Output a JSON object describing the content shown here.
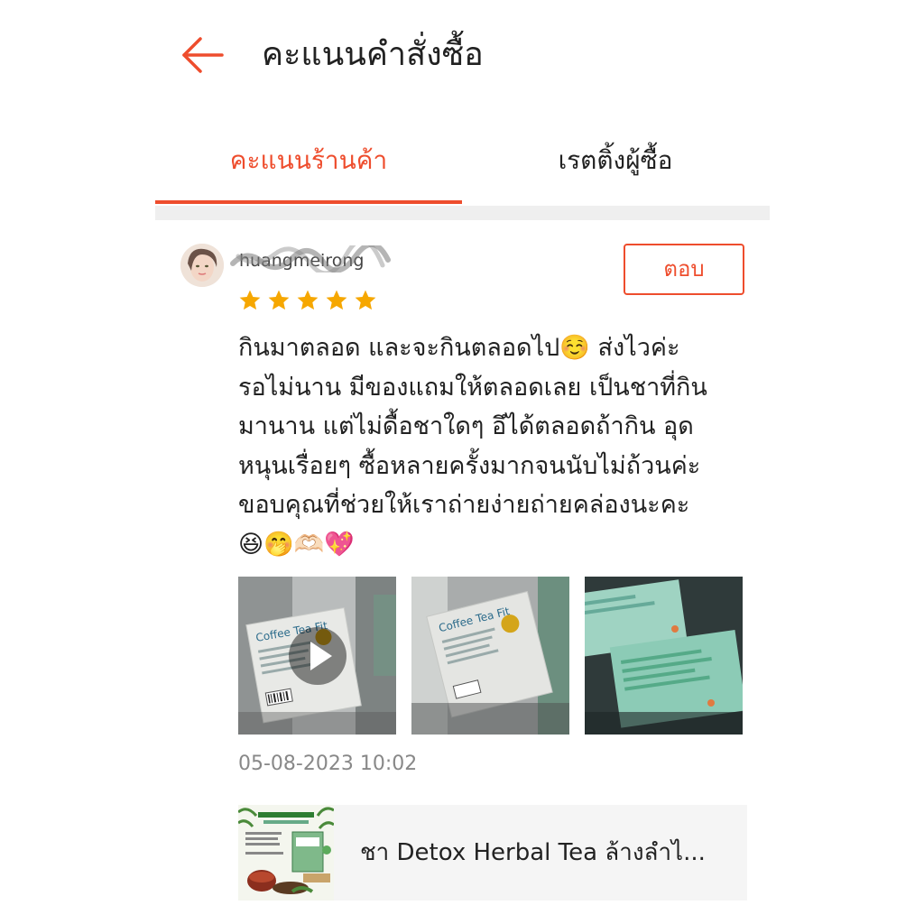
{
  "header": {
    "title": "คะแนนคำสั่งซื้อ",
    "back_icon": "arrow-left-icon",
    "accent_color": "#ee4d2d"
  },
  "tabs": [
    {
      "label": "คะแนนร้านค้า",
      "active": true
    },
    {
      "label": "เรตติ้งผู้ซื้อ",
      "active": false
    }
  ],
  "review": {
    "username": "huangmeirong",
    "rating": 5,
    "reply_label": "ตอบ",
    "text": "กินมาตลอด และจะกินตลอดไป☺️ ส่งไวค่ะ\nรอไม่นาน มีของแถมให้ตลอดเลย เป็นชาที่กิน\nมานาน แต่ไม่ดื้อชาใดๆ อึได้ตลอดถ้ากิน อุด\nหนุนเรื่อยๆ ซื้อหลายครั้งมากจนนับไม่ถ้วนค่ะ\nขอบคุณที่ช่วยให้เราถ่ายง่ายถ่ายคล่องนะคะ\n😆🤭🫶🏻💖",
    "media": [
      {
        "type": "video",
        "label": "Coffee Tea Fit"
      },
      {
        "type": "image",
        "label": "Coffee Tea Fit"
      },
      {
        "type": "image",
        "label": ""
      }
    ],
    "timestamp": "05-08-2023 10:02"
  },
  "product": {
    "name": "ชา Detox Herbal Tea ล้างลำไ..."
  }
}
